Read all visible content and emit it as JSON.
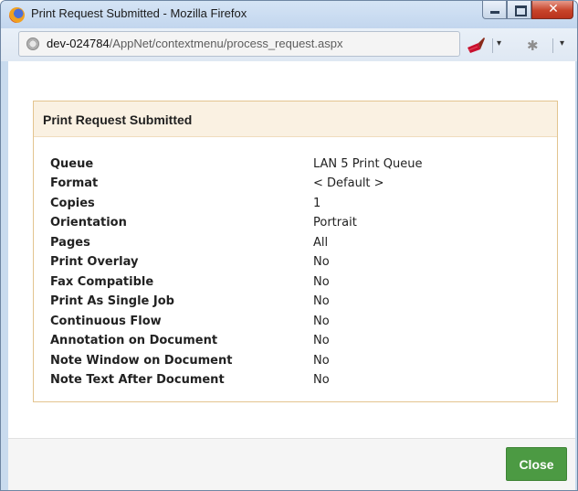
{
  "window": {
    "title": "Print Request Submitted - Mozilla Firefox",
    "close_glyph": "✕"
  },
  "address_bar": {
    "host": "dev-024784",
    "path": "/AppNet/contextmenu/process_request.aspx"
  },
  "toolbar": {
    "dropdown_glyph": "▾",
    "bug_glyph": "✱"
  },
  "dialog": {
    "heading": "Print Request Submitted",
    "rows": [
      {
        "label": "Queue",
        "value": "LAN 5 Print Queue"
      },
      {
        "label": "Format",
        "value": "< Default >"
      },
      {
        "label": "Copies",
        "value": "1"
      },
      {
        "label": "Orientation",
        "value": "Portrait"
      },
      {
        "label": "Pages",
        "value": "All"
      },
      {
        "label": "Print Overlay",
        "value": "No"
      },
      {
        "label": "Fax Compatible",
        "value": "No"
      },
      {
        "label": "Print As Single Job",
        "value": "No"
      },
      {
        "label": "Continuous Flow",
        "value": "No"
      },
      {
        "label": "Annotation on Document",
        "value": "No"
      },
      {
        "label": "Note Window on Document",
        "value": "No"
      },
      {
        "label": "Note Text After Document",
        "value": "No"
      }
    ],
    "close_label": "Close"
  },
  "colors": {
    "close_button": "#4c9a43",
    "panel_border": "#e3c48f",
    "panel_header_bg": "#faf1e2"
  }
}
